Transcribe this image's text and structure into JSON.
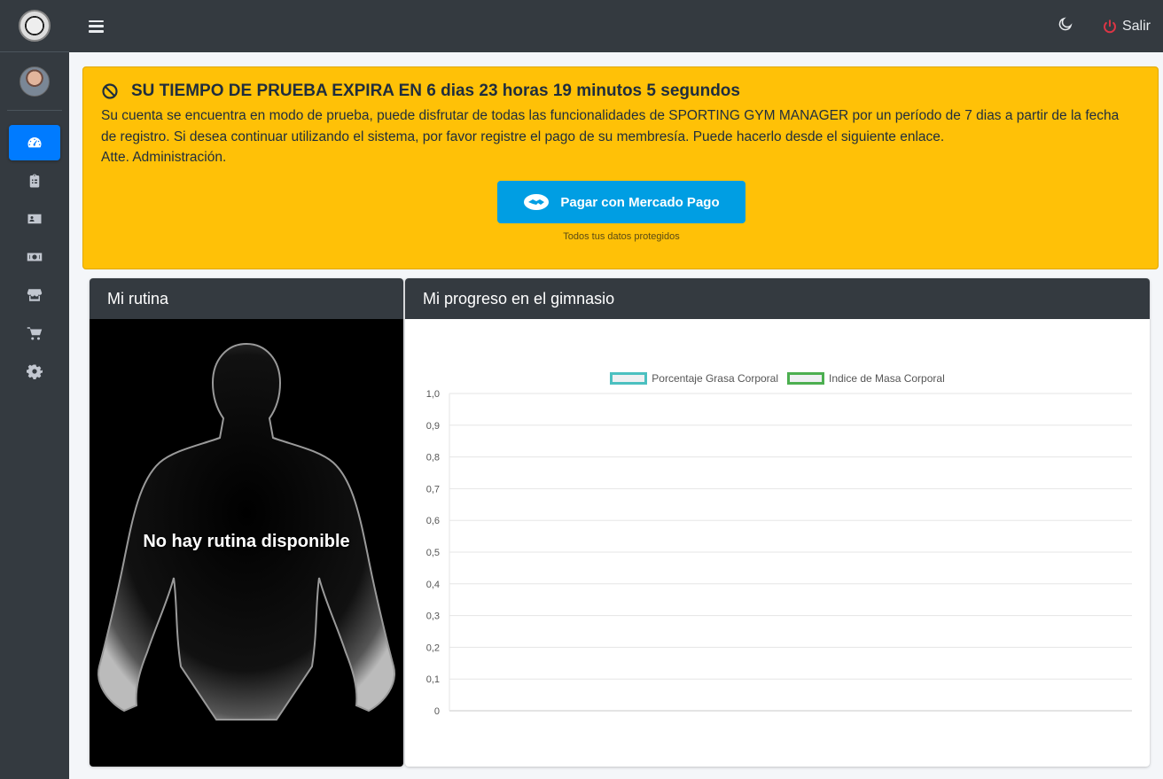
{
  "sidebar": {
    "items": [
      {
        "icon": "dashboard-icon",
        "active": true
      },
      {
        "icon": "clipboard-icon",
        "active": false
      },
      {
        "icon": "id-card-icon",
        "active": false
      },
      {
        "icon": "money-icon",
        "active": false
      },
      {
        "icon": "store-icon",
        "active": false
      },
      {
        "icon": "cart-icon",
        "active": false
      },
      {
        "icon": "gear-icon",
        "active": false
      }
    ]
  },
  "topbar": {
    "logout_label": "Salir",
    "moon_icon": "moon-icon",
    "power_icon": "power-icon",
    "power_color": "#dc3545"
  },
  "alert": {
    "title": "SU TIEMPO DE PRUEBA EXPIRA EN 6 dias 23 horas 19 minutos 5 segundos",
    "line1": "Su cuenta se encuentra en modo de prueba, puede disfrutar de todas las funcionalidades de SPORTING GYM MANAGER por un período de 7 dias a partir de la fecha",
    "line2": "de registro. Si desea continuar utilizando el sistema, por favor registre el pago de su membresía. Puede hacerlo desde el siguiente enlace.",
    "line3": "Atte. Administración.",
    "pay_button": "Pagar con Mercado Pago",
    "pay_note": "Todos tus datos protegidos",
    "color": "#ffc107"
  },
  "routine": {
    "title": "Mi rutina",
    "empty_text": "No hay rutina disponible"
  },
  "progress": {
    "title": "Mi progreso en el gimnasio"
  },
  "chart_data": {
    "type": "line",
    "series": [
      {
        "name": "Porcentaje Grasa Corporal",
        "values": [],
        "color": "#4bc0c0"
      },
      {
        "name": "Indice de Masa Corporal",
        "values": [],
        "color": "#4caf50"
      }
    ],
    "y_ticks": [
      "1,0",
      "0,9",
      "0,8",
      "0,7",
      "0,6",
      "0,5",
      "0,4",
      "0,3",
      "0,2",
      "0,1",
      "0"
    ],
    "ylim": [
      0,
      1
    ],
    "grid": true,
    "legend": "top-center"
  }
}
